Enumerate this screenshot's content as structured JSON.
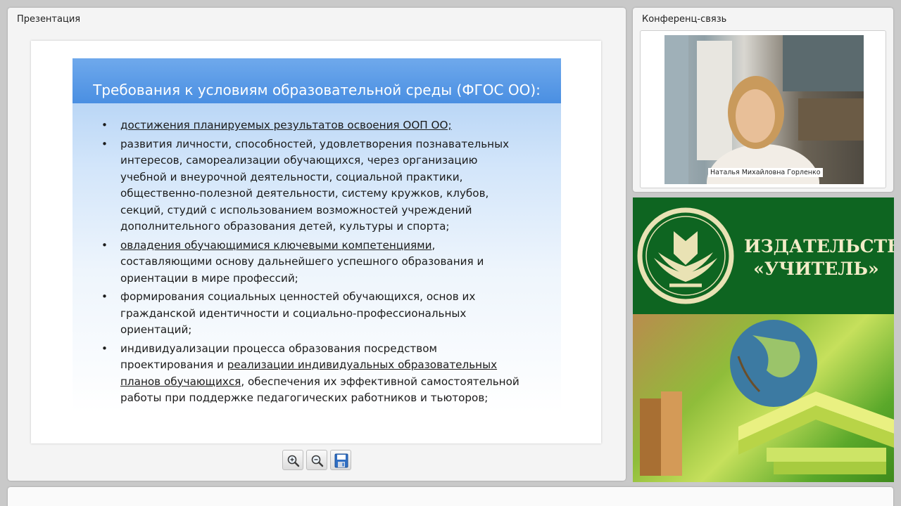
{
  "presentation": {
    "title": "Презентация",
    "slide": {
      "title": "Требования к условиям образовательной среды (ФГОС ОО):",
      "items": [
        {
          "lines": [
            {
              "u": "достижения планируемых результатов освоения ООП ОО;",
              "t": ""
            }
          ]
        },
        {
          "lines": [
            {
              "t": "развития личности, способностей, удовлетворения познавательных"
            },
            {
              "t": "интересов, самореализации обучающихся, через организацию"
            },
            {
              "t": "учебной и внеурочной деятельности, социальной практики,"
            },
            {
              "t": "общественно-полезной деятельности, систему кружков, клубов,"
            },
            {
              "t": "секций, студий с использованием возможностей учреждений"
            },
            {
              "t": "дополнительного образования детей, культуры и спорта;"
            }
          ]
        },
        {
          "lines": [
            {
              "u": "овладения обучающимися ключевыми компетенциями",
              "t": ","
            },
            {
              "t": "составляющими основу дальнейшего успешного образования  и"
            },
            {
              "t": "ориентации в мире профессий;"
            }
          ]
        },
        {
          "lines": [
            {
              "t": "формирования социальных ценностей обучающихся, основ  их"
            },
            {
              "t": "гражданской идентичности и социально-профессиональных"
            },
            {
              "t": "ориентаций;"
            }
          ]
        },
        {
          "lines": [
            {
              "t": "индивидуализации процесса образования посредством"
            },
            {
              "p": "проектирования и ",
              "u": "реализации индивидуальных образовательных"
            },
            {
              "u": "планов обучающихся",
              "t": ", обеспечения их эффективной самостоятельной"
            },
            {
              "t": "работы при поддержке педагогических работников и тьюторов;"
            }
          ]
        }
      ]
    },
    "toolbar": {
      "zoom_in_icon": "zoom-in-icon",
      "zoom_out_icon": "zoom-out-icon",
      "save_icon": "save-icon"
    }
  },
  "conference": {
    "title": "Конференц-связь",
    "participant_name": "Наталья Михайловна Горленко"
  },
  "publisher": {
    "name_line1": "ИЗДАТЕЛЬСТВО",
    "name_line2": "«УЧИТЕЛЬ»",
    "colors": {
      "banner": "#0e6521",
      "text": "#f3ecc8"
    }
  }
}
